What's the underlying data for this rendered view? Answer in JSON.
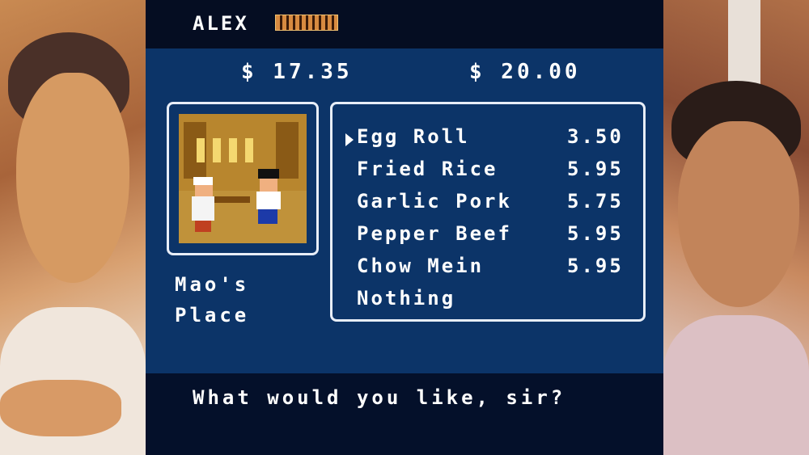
{
  "player": {
    "name": "ALEX",
    "health_bar_icon": "health-bar"
  },
  "money": {
    "current": "$ 17.35",
    "right": "$ 20.00"
  },
  "shop": {
    "name_line1": "Mao's",
    "name_line2": "Place"
  },
  "menu": {
    "items": [
      {
        "label": "Egg Roll",
        "price": "3.50"
      },
      {
        "label": "Fried Rice",
        "price": "5.95"
      },
      {
        "label": "Garlic Pork",
        "price": "5.75"
      },
      {
        "label": "Pepper Beef",
        "price": "5.95"
      },
      {
        "label": "Chow Mein",
        "price": "5.95"
      },
      {
        "label": "Nothing",
        "price": ""
      }
    ],
    "selected_index": 0
  },
  "dialog": {
    "text": "What would you like, sir?"
  },
  "colors": {
    "panel": "#0c3468",
    "frame": "#e8eef8",
    "bar": "#050d22",
    "text": "#ffffff"
  }
}
